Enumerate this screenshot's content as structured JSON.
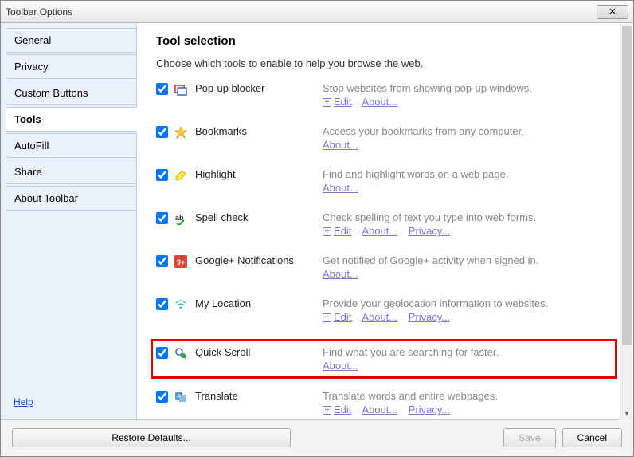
{
  "window": {
    "title": "Toolbar Options"
  },
  "sidebar": {
    "tabs": [
      {
        "label": "General"
      },
      {
        "label": "Privacy"
      },
      {
        "label": "Custom Buttons"
      },
      {
        "label": "Tools"
      },
      {
        "label": "AutoFill"
      },
      {
        "label": "Share"
      },
      {
        "label": "About Toolbar"
      }
    ],
    "help": "Help"
  },
  "content": {
    "heading": "Tool selection",
    "subtitle": "Choose which tools to enable to help you browse the web.",
    "tools": [
      {
        "name": "Pop-up blocker",
        "desc": "Stop websites from showing pop-up windows.",
        "edit": "Edit",
        "about": "About..."
      },
      {
        "name": "Bookmarks",
        "desc": "Access your bookmarks from any computer.",
        "about": "About..."
      },
      {
        "name": "Highlight",
        "desc": "Find and highlight words on a web page.",
        "about": "About..."
      },
      {
        "name": "Spell check",
        "desc": "Check spelling of text you type into web forms.",
        "edit": "Edit",
        "about": "About...",
        "privacy": "Privacy..."
      },
      {
        "name": "Google+ Notifications",
        "desc": "Get notified of Google+ activity when signed in.",
        "about": "About..."
      },
      {
        "name": "My Location",
        "desc": "Provide your geolocation information to websites.",
        "edit": "Edit",
        "about": "About...",
        "privacy": "Privacy..."
      },
      {
        "name": "Quick Scroll",
        "desc": "Find what you are searching for faster.",
        "about": "About..."
      },
      {
        "name": "Translate",
        "desc": "Translate words and entire webpages.",
        "edit": "Edit",
        "about": "About...",
        "privacy": "Privacy..."
      }
    ]
  },
  "footer": {
    "restore": "Restore Defaults...",
    "save": "Save",
    "cancel": "Cancel"
  }
}
